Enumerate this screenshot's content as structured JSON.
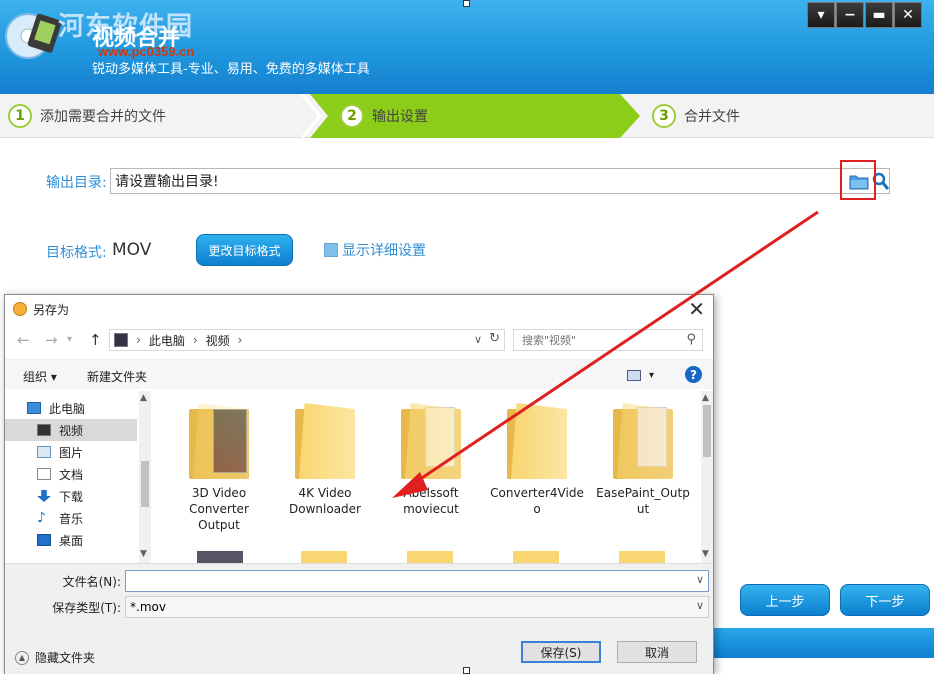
{
  "app": {
    "watermark": "河东软件园",
    "watermark_url": "www.pc0359.cn",
    "title": "视频合并",
    "subtitle": "锐动多媒体工具-专业、易用、免费的多媒体工具",
    "window_controls": [
      "▾",
      "−",
      "▬",
      "✕"
    ]
  },
  "steps": [
    {
      "num": "1",
      "label": "添加需要合并的文件"
    },
    {
      "num": "2",
      "label": "输出设置"
    },
    {
      "num": "3",
      "label": "合并文件"
    }
  ],
  "output": {
    "dir_label": "输出目录:",
    "dir_value": "请设置输出目录!",
    "format_label": "目标格式:",
    "format_value": "MOV",
    "change_format_button": "更改目标格式",
    "detail_settings_label": "显示详细设置"
  },
  "nav_buttons": {
    "prev": "上一步",
    "next": "下一步"
  },
  "dialog": {
    "title": "另存为",
    "breadcrumb": [
      "此电脑",
      "视频"
    ],
    "search_placeholder": "搜索\"视频\"",
    "toolbar": {
      "organize": "组织 ▾",
      "new_folder": "新建文件夹"
    },
    "nav_items": [
      {
        "label": "此电脑",
        "icon": "computer-icon"
      },
      {
        "label": "视频",
        "icon": "video-folder-icon",
        "selected": true
      },
      {
        "label": "图片",
        "icon": "pictures-icon"
      },
      {
        "label": "文档",
        "icon": "documents-icon"
      },
      {
        "label": "下载",
        "icon": "downloads-icon"
      },
      {
        "label": "音乐",
        "icon": "music-icon"
      },
      {
        "label": "桌面",
        "icon": "desktop-icon"
      }
    ],
    "files": [
      {
        "name": "3D Video\nConverter\nOutput",
        "thumb": "video"
      },
      {
        "name": "4K Video\nDownloader",
        "thumb": "plain"
      },
      {
        "name": "Abelssoft\nmoviecut",
        "thumb": "doc"
      },
      {
        "name": "Converter4Vide\no",
        "thumb": "plain"
      },
      {
        "name": "EasePaint_Outp\nut",
        "thumb": "film"
      }
    ],
    "filename_label": "文件名(N):",
    "filename_value": "",
    "filetype_label": "保存类型(T):",
    "filetype_value": "*.mov",
    "hide_folders": "隐藏文件夹",
    "save_button": "保存(S)",
    "cancel_button": "取消"
  },
  "colors": {
    "header_blue": "#1e95dc",
    "step_active_green": "#8ccd19",
    "annotation_red": "#e02020",
    "button_blue": "#0e80cf"
  }
}
